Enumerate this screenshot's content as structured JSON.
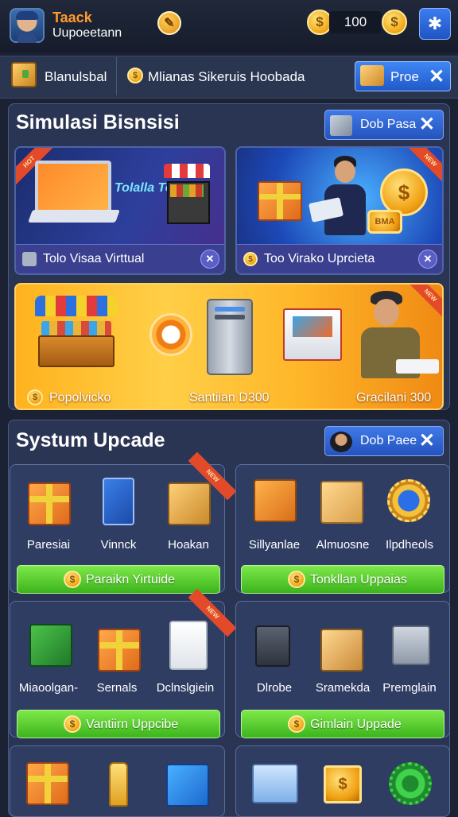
{
  "player": {
    "name": "Taack",
    "status": "Uupoeetann"
  },
  "currency": {
    "amount": "100"
  },
  "header_icons": [
    "edit-icon",
    "coin-icon",
    "gear-icon"
  ],
  "subbar": {
    "tab1": "Blanulsbal",
    "tab2": "Mlianas Sikeruis Hoobada",
    "pro_label": "Proe"
  },
  "business": {
    "title": "Simulasi Bisnsisi",
    "pill_label": "Dob Pasa",
    "card_a": {
      "art_text": "Tolalla Tocal",
      "footer": "Tolo Visaa Virttual"
    },
    "card_b": {
      "art_text": "BMA",
      "footer": "Too Virako Uprcieta"
    },
    "card_c": {
      "label1": "Popolvicko",
      "label2": "Santiian D300",
      "label3": "Gracilani 300"
    }
  },
  "upgrade": {
    "title": "Systum Upcade",
    "pill_label": "Dob Paee",
    "cards": [
      {
        "items": [
          "Paresiai",
          "Vinnck",
          "Hoakan"
        ],
        "button": "Paraikn Yirtuide"
      },
      {
        "items": [
          "Sillyanlae",
          "Almuosne",
          "Ilpdheols"
        ],
        "button": "Tonkllan Uppaias"
      },
      {
        "items": [
          "Miaoolgan-",
          "Sernals",
          "Dclnslgiein"
        ],
        "button": "Vantiirn Uppcibe"
      },
      {
        "items": [
          "Dlrobe",
          "Sramekda",
          "Premglain"
        ],
        "button": "Gimlain Uppade"
      }
    ]
  },
  "colors": {
    "accent_orange": "#ff9a2e",
    "button_blue": "#2f6ee0",
    "button_green": "#4cc22a",
    "panel": "#2a3554"
  }
}
